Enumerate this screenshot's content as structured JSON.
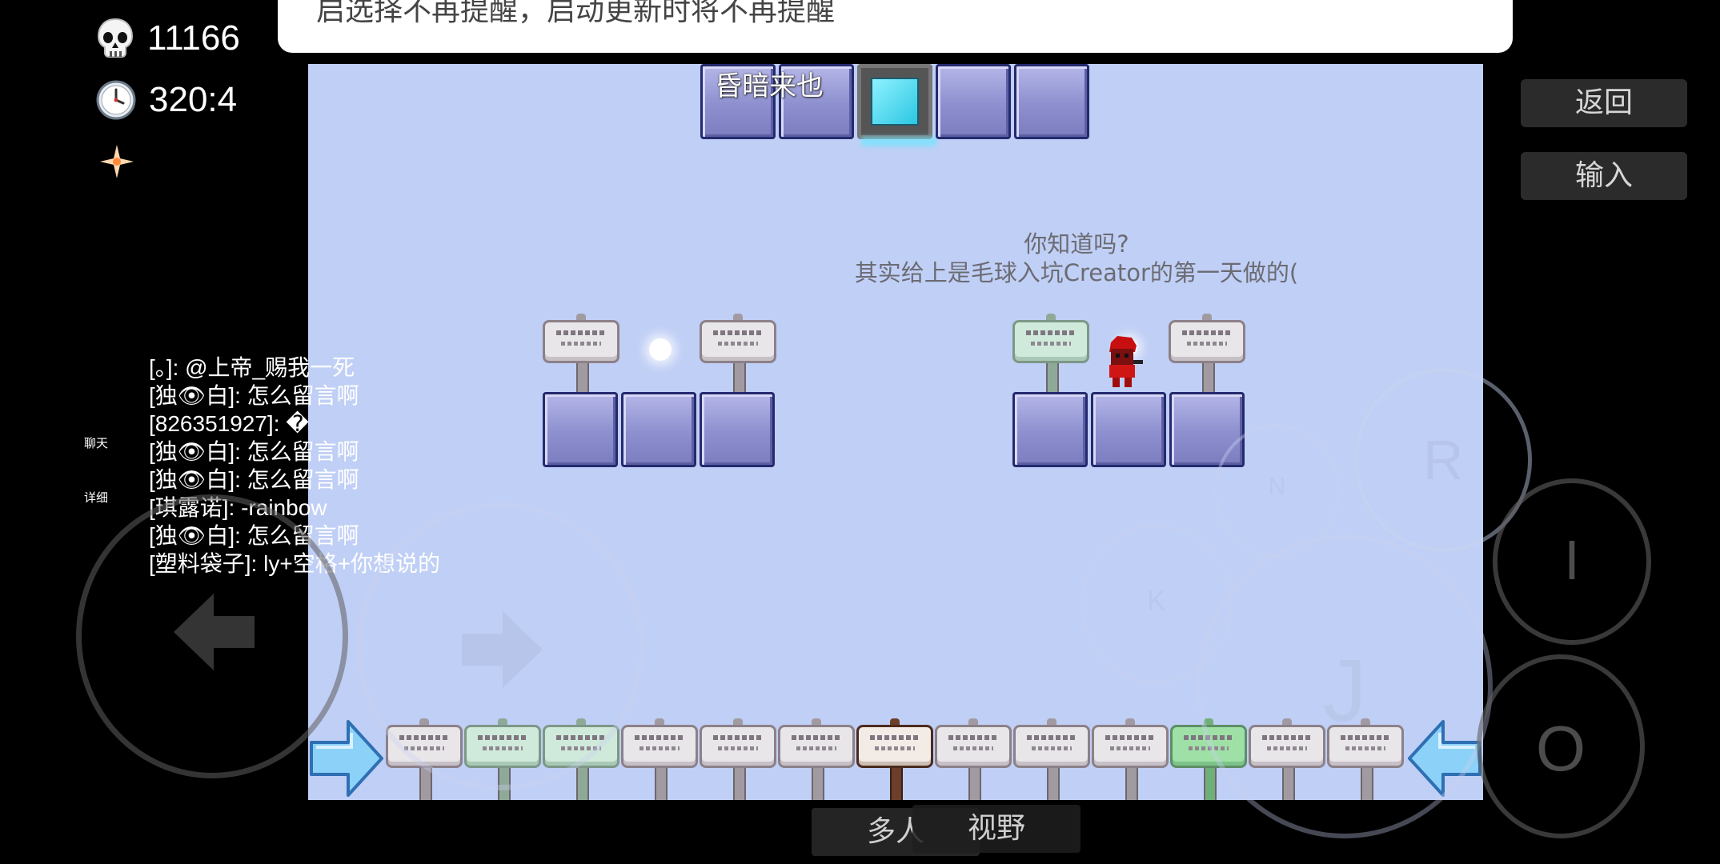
{
  "toast": {
    "text": "启选择不再提醒，启动更新时将不再提醒"
  },
  "hud": {
    "deaths": "11166",
    "time": "320:4"
  },
  "level": {
    "title": "昏暗来也",
    "tip_line1": "你知道吗?",
    "tip_line2": "其实给上是毛球入坑Creator的第一天做的("
  },
  "side_buttons": {
    "back": "返回",
    "input": "输入"
  },
  "bottom_buttons": {
    "multiplayer": "多人",
    "view": "视野"
  },
  "chat": {
    "tab_chat": "聊天",
    "tab_detail": "详细",
    "messages": [
      "[。]: @上帝_赐我一死",
      "[独👁白]: 怎么留言啊",
      "[826351927]: �",
      "[独👁白]: 怎么留言啊",
      "[独👁白]: 怎么留言啊",
      "[琪露诺]: -rainbow",
      "[独👁白]: 怎么留言啊",
      "[塑料袋子]: ly+空格+你想说的"
    ]
  },
  "controls": {
    "n": "N",
    "r": "R",
    "i": "I",
    "k": "K",
    "j": "J",
    "o": "O"
  },
  "icons": {
    "skull": "skull-icon",
    "clock": "clock-icon",
    "sparkle": "sparkle-icon",
    "left_arrow": "left-arrow-icon",
    "right_arrow": "right-arrow-icon"
  },
  "colors": {
    "background": "#000000",
    "viewport": "#c0cff5",
    "block": "#8d8fcf",
    "block_border": "#252a6e"
  }
}
